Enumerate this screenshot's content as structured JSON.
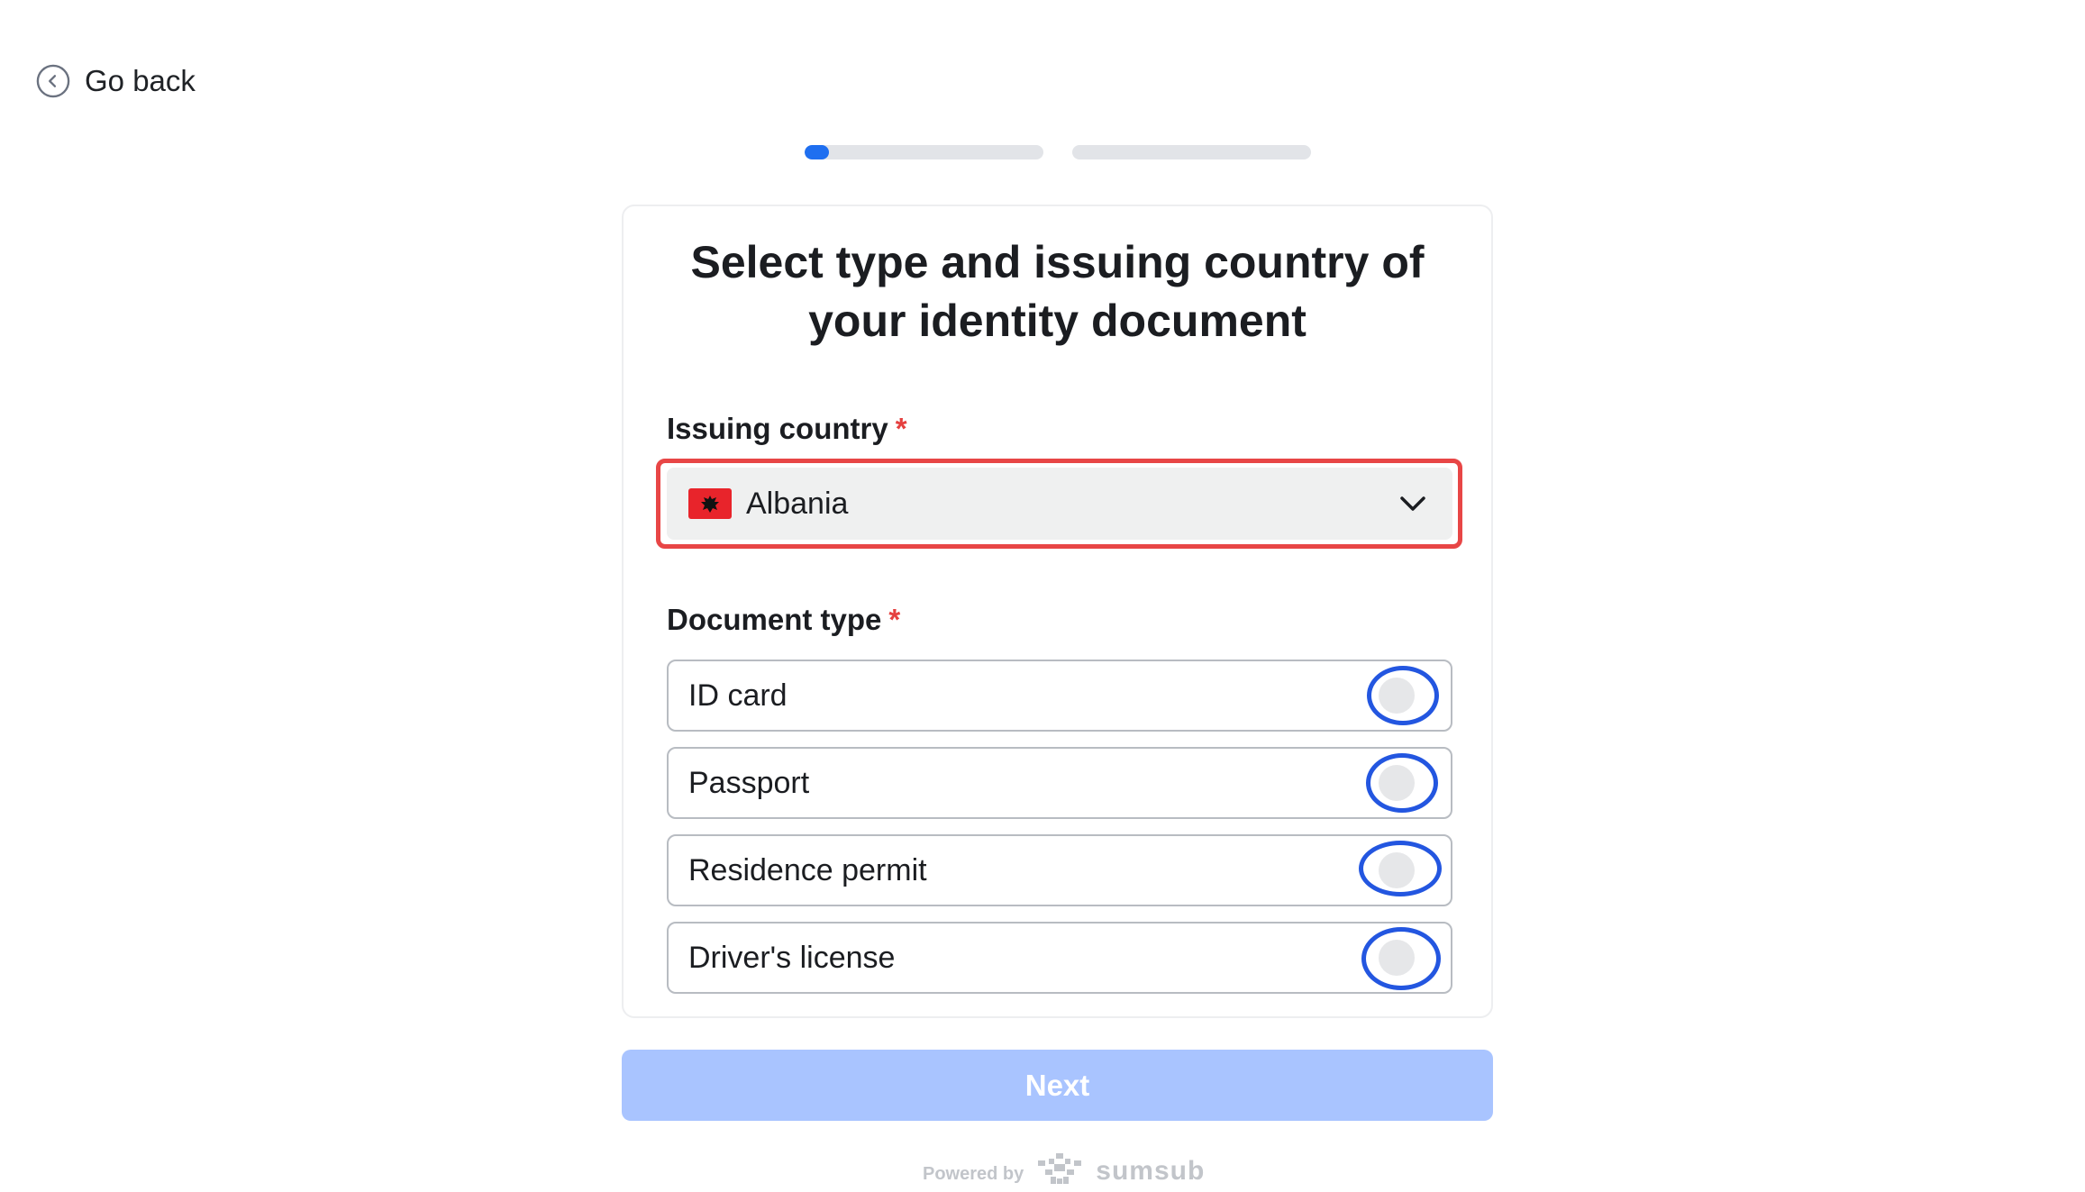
{
  "nav": {
    "back_label": "Go back"
  },
  "progress": {
    "steps": [
      {
        "fraction": 0.1
      },
      {
        "fraction": 0.0
      }
    ],
    "accent": "#1f6ff0",
    "track": "#e2e4e8"
  },
  "card": {
    "title_line1": "Select type and issuing country of",
    "title_line2": "your identity document",
    "country": {
      "label": "Issuing country",
      "required_mark": "*",
      "value": "Albania",
      "flag_icon": "albania-flag-icon",
      "highlight_color": "#e84646"
    },
    "document_type": {
      "label": "Document type",
      "required_mark": "*",
      "options": [
        {
          "label": "ID card",
          "selected": false
        },
        {
          "label": "Passport",
          "selected": false
        },
        {
          "label": "Residence permit",
          "selected": false
        },
        {
          "label": "Driver's license",
          "selected": false
        }
      ],
      "ring_color": "#2356e0"
    }
  },
  "next_button": {
    "label": "Next",
    "enabled": false,
    "color": "#a9c4ff"
  },
  "footer": {
    "powered_by": "Powered by",
    "brand": "sumsub"
  }
}
